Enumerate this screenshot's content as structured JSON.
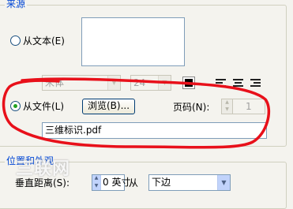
{
  "source_group": {
    "legend": "来源",
    "from_text_label": "从文本(E)",
    "font_name": "宋体",
    "font_size": "24",
    "font_color": "#000000",
    "from_file_label": "从文件(L)",
    "browse_label": "浏览(B)...",
    "page_label": "页码(N):",
    "page_value": "1",
    "file_name": "三维标识.pdf"
  },
  "position_group": {
    "legend": "位置和外观",
    "vertical_distance_label": "垂直距离(S):",
    "vertical_distance_value": "0 英寸",
    "from_label": "从",
    "from_option": "下边"
  },
  "watermark_text": "三联网",
  "annotation_color": "#e8101a"
}
